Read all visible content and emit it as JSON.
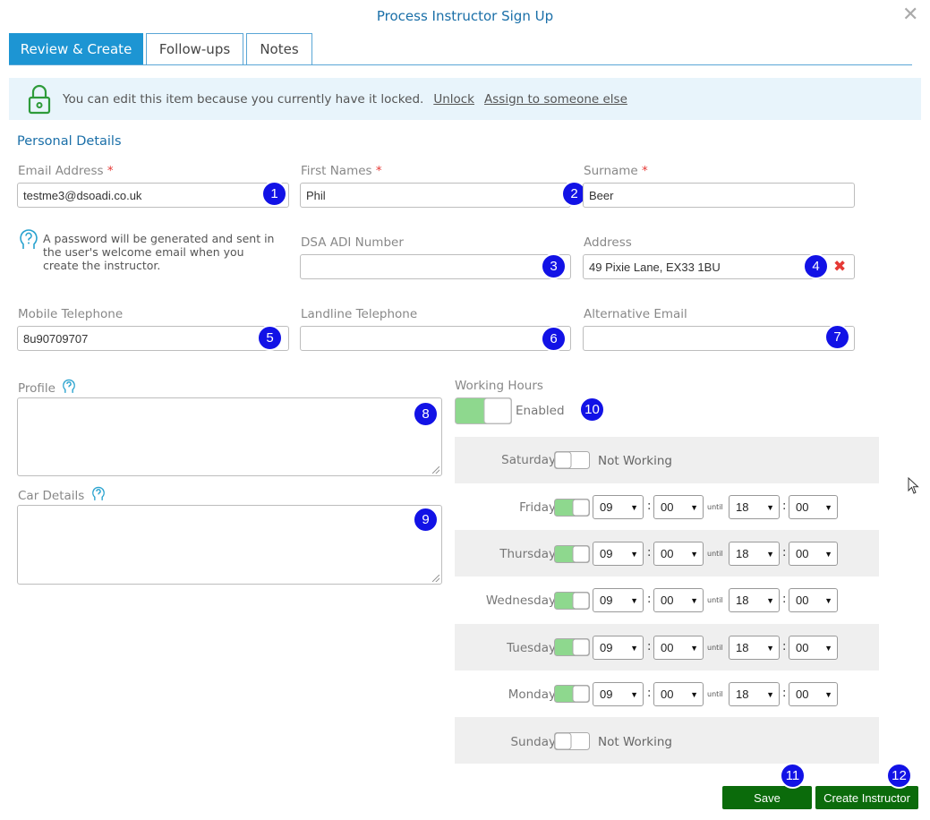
{
  "dialog": {
    "title": "Process Instructor Sign Up"
  },
  "tabs": [
    {
      "label": "Review & Create",
      "active": true
    },
    {
      "label": "Follow-ups",
      "active": false
    },
    {
      "label": "Notes",
      "active": false
    }
  ],
  "lock_notice": {
    "text": "You can edit this item because you currently have it locked.",
    "unlock_link": "Unlock",
    "assign_link": "Assign to someone else"
  },
  "section": {
    "title": "Personal Details"
  },
  "fields": {
    "email": {
      "label": "Email Address",
      "value": "testme3@dsoadi.co.uk",
      "required": "*"
    },
    "first_names": {
      "label": "First Names",
      "value": "Phil",
      "required": "*"
    },
    "surname": {
      "label": "Surname",
      "value": "Beer",
      "required": "*"
    },
    "password_info": "A password will be generated and sent in the user's welcome email when you create the instructor.",
    "dsa_adi": {
      "label": "DSA ADI Number",
      "value": ""
    },
    "address": {
      "label": "Address",
      "value": "49 Pixie Lane, EX33 1BU"
    },
    "mobile": {
      "label": "Mobile Telephone",
      "value": "8u90709707"
    },
    "landline": {
      "label": "Landline Telephone",
      "value": ""
    },
    "alt_email": {
      "label": "Alternative Email",
      "value": ""
    },
    "profile": {
      "label": "Profile",
      "value": ""
    },
    "car_details": {
      "label": "Car Details",
      "value": ""
    }
  },
  "working_hours": {
    "label": "Working Hours",
    "status": "Enabled",
    "until_label": "until",
    "not_working_label": "Not Working",
    "days": [
      {
        "name": "Saturday",
        "working": false
      },
      {
        "name": "Friday",
        "working": true,
        "start_h": "09",
        "start_m": "00",
        "end_h": "18",
        "end_m": "00"
      },
      {
        "name": "Thursday",
        "working": true,
        "start_h": "09",
        "start_m": "00",
        "end_h": "18",
        "end_m": "00"
      },
      {
        "name": "Wednesday",
        "working": true,
        "start_h": "09",
        "start_m": "00",
        "end_h": "18",
        "end_m": "00"
      },
      {
        "name": "Tuesday",
        "working": true,
        "start_h": "09",
        "start_m": "00",
        "end_h": "18",
        "end_m": "00"
      },
      {
        "name": "Monday",
        "working": true,
        "start_h": "09",
        "start_m": "00",
        "end_h": "18",
        "end_m": "00"
      },
      {
        "name": "Sunday",
        "working": false
      }
    ]
  },
  "badges": [
    "1",
    "2",
    "3",
    "4",
    "5",
    "6",
    "7",
    "8",
    "9",
    "10",
    "11",
    "12"
  ],
  "buttons": {
    "save": "Save",
    "create": "Create Instructor"
  },
  "colors": {
    "accent": "#1d95d3",
    "title": "#1a6fa8",
    "badge": "#1212e6",
    "button": "#0b6b0b",
    "toggle_on": "#8ed88e",
    "error": "#e53935"
  },
  "icons": [
    "close-icon",
    "lock-icon",
    "help-icon",
    "remove-icon",
    "chevron-down-icon",
    "mouse-cursor-icon"
  ]
}
